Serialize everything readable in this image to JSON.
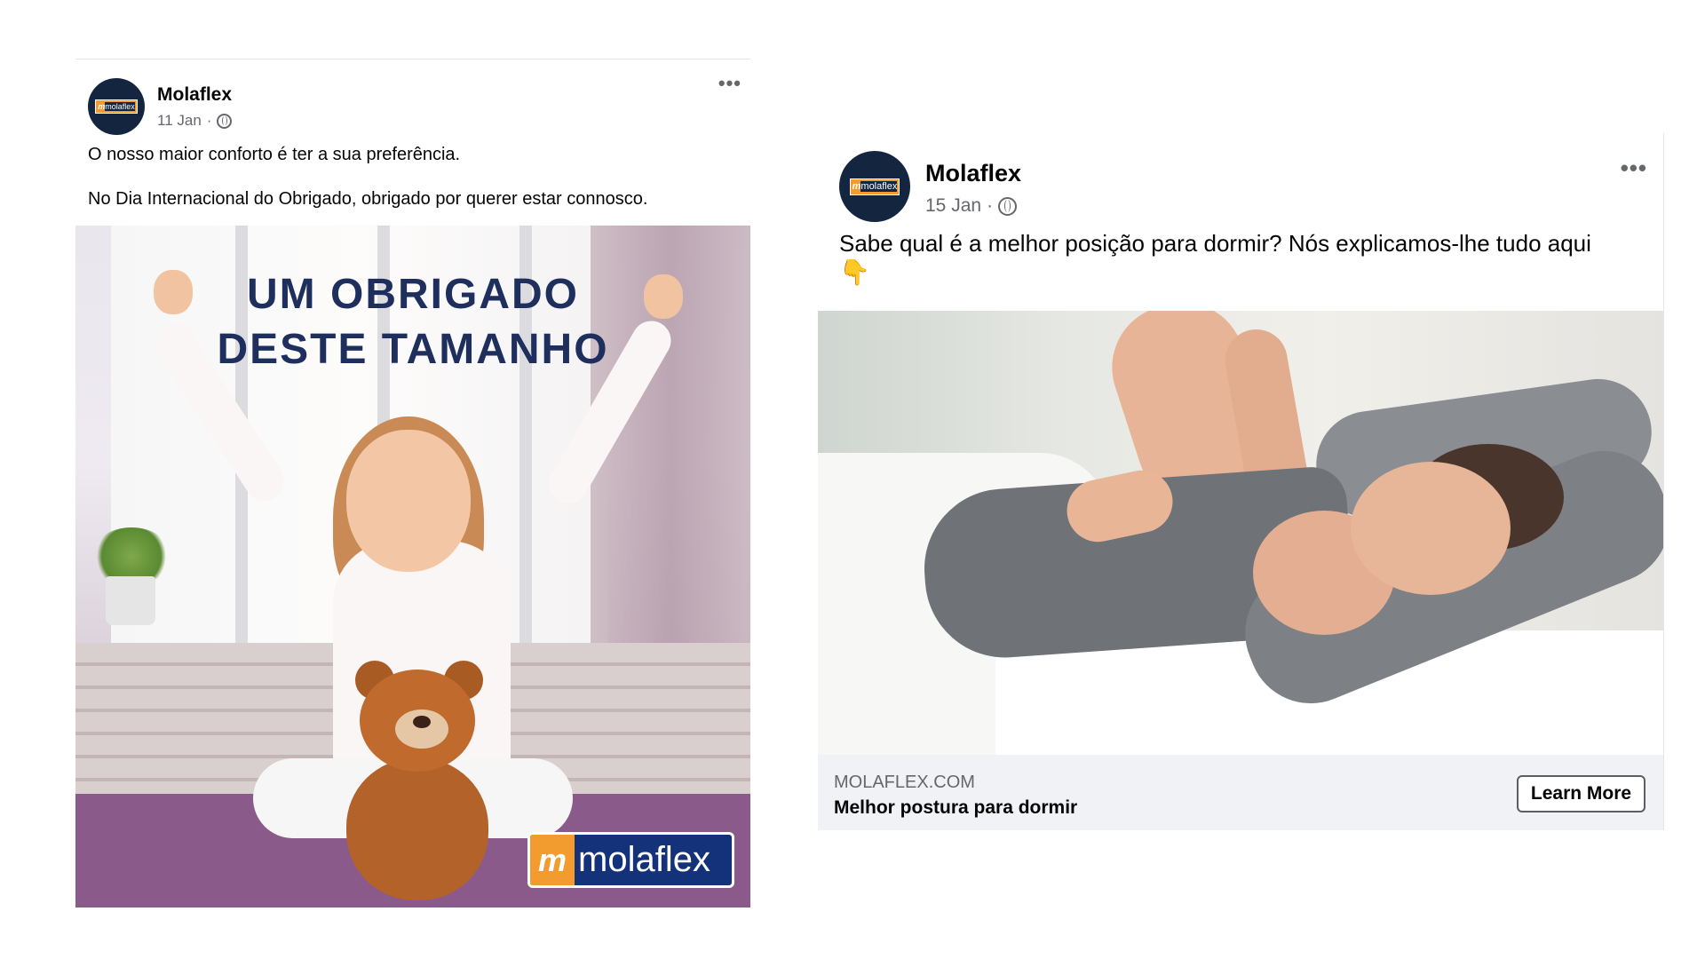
{
  "posts": [
    {
      "page_name": "Molaflex",
      "avatar_logo_mark": "m",
      "avatar_logo_text": "molaflex",
      "date": "11 Jan",
      "separator": "·",
      "audience_icon": "globe-icon",
      "more_icon": "•••",
      "text_line_1": "O nosso maior conforto é ter a sua preferência.",
      "text_line_2": "No Dia Internacional do Obrigado, obrigado por querer estar connosco.",
      "image": {
        "headline_line_1": "UM OBRIGADO",
        "headline_line_2": "DESTE TAMANHO",
        "brand_mark": "m",
        "brand_text": "molaflex"
      }
    },
    {
      "page_name": "Molaflex",
      "avatar_logo_mark": "m",
      "avatar_logo_text": "molaflex",
      "date": "15 Jan",
      "separator": "·",
      "audience_icon": "globe-icon",
      "more_icon": "•••",
      "text": "Sabe qual é a melhor posição para dormir? Nós explicamos-lhe tudo aqui",
      "text_emoji": "👇",
      "link": {
        "domain": "MOLAFLEX.COM",
        "title": "Melhor postura para dormir",
        "cta": "Learn More"
      }
    }
  ],
  "colors": {
    "brand_navy": "#13253f",
    "brand_orange": "#f29b2e",
    "headline_blue": "#1e2f5e",
    "meta_gray": "#65676b"
  }
}
